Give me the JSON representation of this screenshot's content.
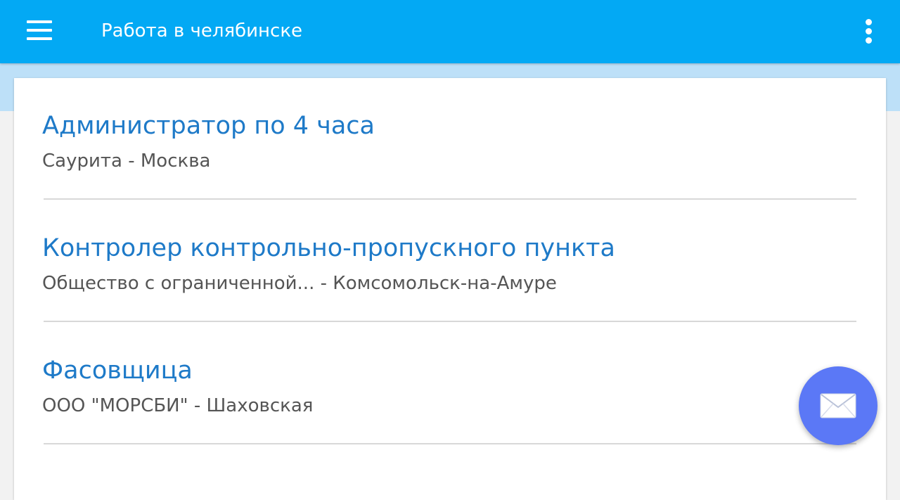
{
  "app_bar": {
    "title": "Работа в челябинске",
    "menu_icon": "hamburger-menu-icon",
    "overflow_icon": "more-vertical-icon"
  },
  "jobs": [
    {
      "title": "Администратор по 4 часа",
      "subtitle": "Саурита - Москва"
    },
    {
      "title": "Контролер контрольно-пропускного пункта",
      "subtitle": "Общество с ограниченной... - Комсомольск-на-Амуре"
    },
    {
      "title": "Фасовщица",
      "subtitle": "ООО \"МОРСБИ\" - Шаховская"
    }
  ],
  "fab": {
    "icon": "envelope-icon"
  },
  "colors": {
    "app_bar": "#03a9f4",
    "header_band": "#bde0f8",
    "job_title": "#1e7ac8",
    "fab": "#5b78f6"
  }
}
